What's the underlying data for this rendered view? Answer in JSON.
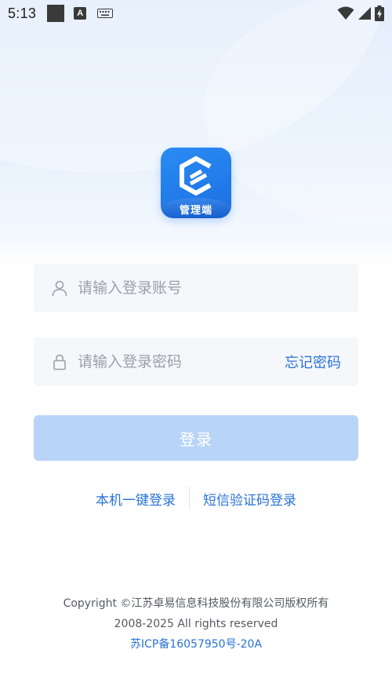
{
  "status_bar": {
    "time": "5:13",
    "icons": [
      "square-icon",
      "a-notification-icon",
      "keyboard-icon",
      "wifi-icon",
      "signal-icon",
      "battery-charging-icon"
    ]
  },
  "logo": {
    "label": "管理端"
  },
  "account": {
    "placeholder": "请输入登录账号",
    "value": ""
  },
  "password": {
    "placeholder": "请输入登录密码",
    "value": "",
    "forgot_label": "忘记密码"
  },
  "login_button": {
    "label": "登录"
  },
  "alt_login": {
    "one_click": "本机一键登录",
    "sms": "短信验证码登录"
  },
  "footer": {
    "copyright": "Copyright ©江苏卓易信息科技股份有限公司版权所有",
    "rights": "2008-2025 All rights reserved",
    "icp": "苏ICP备16057950号-20A"
  },
  "colors": {
    "accent": "#2a72d6",
    "brand_blue": "#1c6fe2",
    "button_disabled": "#b8d4f7",
    "input_bg": "#f5f7fb"
  }
}
